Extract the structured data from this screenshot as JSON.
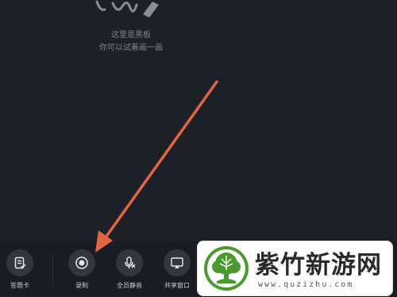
{
  "blackboard": {
    "hint_line1": "这里是黑板",
    "hint_line2": "你可以试着画一画"
  },
  "toolbar": {
    "items": [
      {
        "label": "答题卡",
        "icon": "answer-card-icon"
      },
      {
        "label": "录制",
        "icon": "record-icon"
      },
      {
        "label": "全员静音",
        "icon": "mute-all-icon"
      },
      {
        "label": "共享窗口",
        "icon": "share-window-icon"
      }
    ]
  },
  "watermark": {
    "title": "紫竹新游网",
    "url": "www.quzizhu.com"
  },
  "colors": {
    "background": "#1e2028",
    "toolbar": "#1a1c23",
    "button": "#33363f",
    "arrow": "#e0673f",
    "logo_green": "#4a9a2f"
  }
}
